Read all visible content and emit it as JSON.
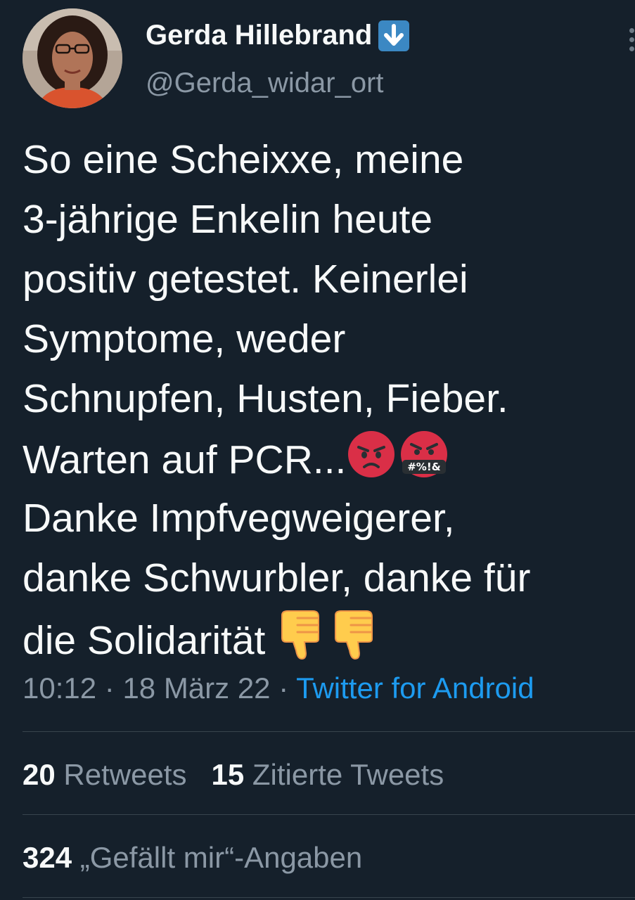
{
  "user": {
    "display_name": "Gerda Hillebrand",
    "handle": "@Gerda_widar_ort",
    "name_emoji": "down-arrow-button-icon"
  },
  "tweet": {
    "lines": [
      "So eine Scheixxe, meine",
      "3-jährige Enkelin heute",
      "positiv getestet. Keinerlei",
      "Symptome, weder",
      "Schnupfen, Husten, Fieber.",
      "Warten auf PCR...",
      "Danke Impfvegweigerer,",
      "danke Schwurbler, danke für",
      "die Solidarität"
    ],
    "emojis_line6": [
      "angry-face-icon",
      "face-with-symbols-on-mouth-icon"
    ],
    "emoji_symbols_text": "#%!&",
    "emojis_line9": [
      "thumbs-down-icon",
      "thumbs-down-icon"
    ]
  },
  "meta": {
    "time": "10:12",
    "sep1": " · ",
    "date": "18 März 22",
    "sep2": " · ",
    "source": "Twitter for Android"
  },
  "stats": {
    "retweets_count": "20",
    "retweets_label": "Retweets",
    "quotes_count": "15",
    "quotes_label": "Zitierte Tweets",
    "likes_count": "324",
    "likes_label": "„Gefällt mir“-Angaben"
  },
  "colors": {
    "background": "#15202b",
    "text": "#f7f9f9",
    "secondary": "#8b98a5",
    "link": "#1d9bf0",
    "divider": "#38444d"
  }
}
